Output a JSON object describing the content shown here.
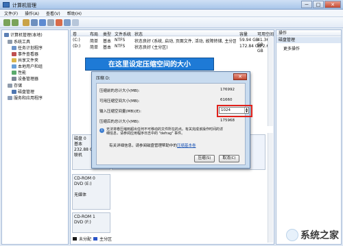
{
  "window": {
    "title": "计算机管理",
    "controls": [
      "－",
      "□",
      "✕"
    ]
  },
  "menubar": [
    "文件(F)",
    "操作(A)",
    "查看(V)",
    "帮助(H)"
  ],
  "tree": {
    "root": "计算机管理(本地)",
    "items": [
      "系统工具",
      "任务计划程序",
      "事件查看器",
      "共享文件夹",
      "本地用户和组",
      "性能",
      "设备管理器",
      "存储",
      "磁盘管理",
      "服务和应用程序"
    ]
  },
  "columns": {
    "headers": [
      "卷",
      "布局",
      "类型",
      "文件系统",
      "状态",
      "容量",
      "可用空间"
    ]
  },
  "volumes": [
    {
      "name": "(C:)",
      "layout": "简单",
      "type": "基本",
      "fs": "NTFS",
      "status": "状态良好 (系统, 启动, 页面文件, 活动, 故障转储, 主分区)",
      "capacity": "59.94 GB",
      "free": "41.36 GB"
    },
    {
      "name": "(D:)",
      "layout": "简单",
      "type": "基本",
      "fs": "NTFS",
      "status": "状态良好 (主分区)",
      "capacity": "172.84 GB",
      "free": "172.63 GB"
    }
  ],
  "actions": {
    "header": "操作",
    "sub": "磁盘管理",
    "more": "更多操作"
  },
  "disks": [
    {
      "name": "磁盘 0",
      "type": "基本",
      "size": "232.88 GB",
      "state": "联机"
    },
    {
      "name": "CD-ROM 0",
      "type": "DVD (E:)",
      "size": "",
      "state": "无媒体"
    },
    {
      "name": "CD-ROM 1",
      "type": "DVD (F:)",
      "size": "",
      "state": ""
    }
  ],
  "legend": [
    "未分配",
    "主分区"
  ],
  "dialog": {
    "title": "压缩 D:",
    "rows": [
      {
        "label": "压缩前的总计大小(MB):",
        "value": "176992"
      },
      {
        "label": "可用压缩空间大小(MB):",
        "value": "61660"
      },
      {
        "label": "输入压缩空间量(MB)(E):",
        "value": "1024"
      },
      {
        "label": "压缩后的总计大小(MB):",
        "value": "175968"
      }
    ],
    "note": "无法将卷压缩到超出任何不可移动的文件所在的点。有关完成该操作时间的详细信息，请参阅应用程序日志中的 \"defrag\" 事件。",
    "help_prefix": "有关详细信息，请参阅磁盘管理帮助中的",
    "help_link": "压缩基本卷",
    "buttons": [
      "压缩(S)",
      "取消(C)"
    ]
  },
  "callout": "在这里设定压缩空间的大小",
  "watermark": "系统之家",
  "colors": {
    "callout": "#1e7ad6",
    "highlight": "#e0201a",
    "legend_unallocated": "#1a1a1a",
    "legend_primary": "#2a55c8"
  }
}
